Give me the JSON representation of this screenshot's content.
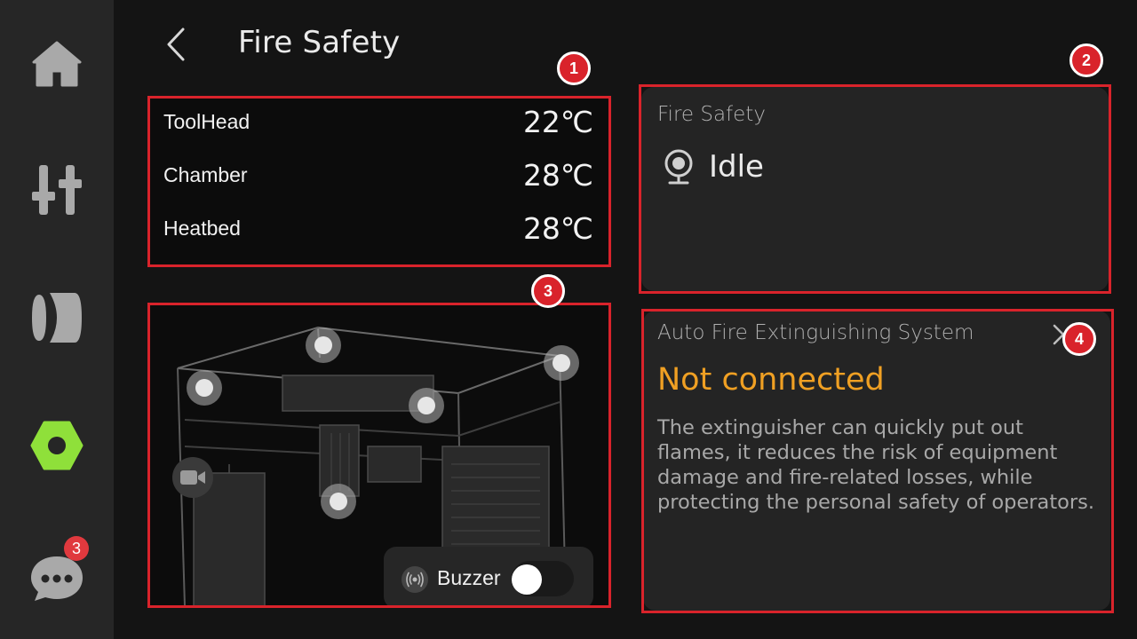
{
  "sidebar": {
    "items": [
      {
        "name": "home",
        "icon": "home-icon"
      },
      {
        "name": "controls",
        "icon": "sliders-icon"
      },
      {
        "name": "filament",
        "icon": "filament-icon"
      },
      {
        "name": "settings",
        "icon": "hex-nut-icon",
        "active": true,
        "color": "#8fe03a"
      },
      {
        "name": "messages",
        "icon": "chat-icon",
        "badge": "3"
      }
    ]
  },
  "header": {
    "title": "Fire Safety"
  },
  "markers": [
    "1",
    "2",
    "3",
    "4"
  ],
  "temperatures": [
    {
      "label": "ToolHead",
      "value": "22℃"
    },
    {
      "label": "Chamber",
      "value": "28℃"
    },
    {
      "label": "Heatbed",
      "value": "28℃"
    }
  ],
  "printer": {
    "buzzer_label": "Buzzer",
    "buzzer_on": false
  },
  "fire_safety_card": {
    "heading": "Fire Safety",
    "status": "Idle"
  },
  "extinguisher_card": {
    "heading": "Auto Fire Extinguishing System",
    "status": "Not connected",
    "status_color": "#f0a023",
    "description": "The extinguisher can quickly put out flames, it reduces the risk of equipment damage and fire-related losses, while protecting the personal safety of operators."
  }
}
